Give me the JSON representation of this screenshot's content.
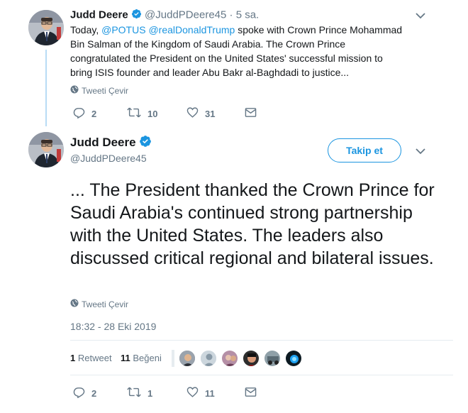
{
  "tweet1": {
    "name": "Judd Deere",
    "handle": "@JuddPDeere45",
    "separator": "·",
    "time": "5 sa.",
    "mention1": "@POTUS",
    "mention2": "@realDonaldTrump",
    "text_after_mentions": " spoke with Crown Prince Mohammad Bin Salman of the Kingdom of Saudi Arabia. The Crown Prince congratulated the President on the United States' successful mission to bring ISIS founder and leader Abu Bakr al-Baghdadi to justice...",
    "text_before": "Today, ",
    "translate_label": "Tweeti Çevir",
    "replies": "2",
    "retweets": "10",
    "likes": "31"
  },
  "tweet2": {
    "name": "Judd Deere",
    "handle": "@JuddPDeere45",
    "follow_label": "Takip et",
    "text": "... The President thanked the Crown Prince for Saudi Arabia's continued strong partnership with the United States. The leaders also discussed critical regional and bilateral issues.",
    "translate_label": "Tweeti Çevir",
    "timestamp": "18:32 - 28 Eki 2019",
    "retweet_count": "1",
    "retweet_label": "Retweet",
    "like_count": "11",
    "like_label": "Beğeni",
    "replies": "2",
    "retweets": "1",
    "likes": "11"
  },
  "colors": {
    "accent": "#1b95e0",
    "text": "#14171a",
    "muted": "#657786",
    "thread_line": "#b8dcf5"
  }
}
